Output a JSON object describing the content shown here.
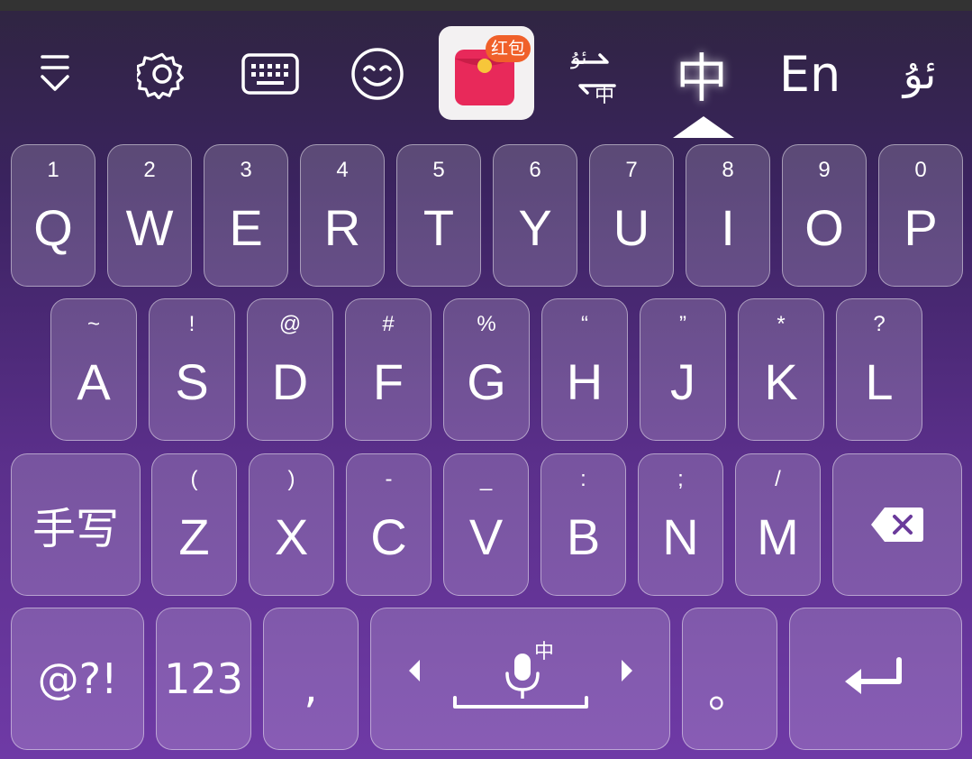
{
  "toolbar": {
    "items": [
      "collapse-icon",
      "settings-icon",
      "keyboard-icon",
      "emoji-icon",
      "red-packet-icon",
      "translate-icon"
    ],
    "hongbao_badge": "红包",
    "translate_top": "ئۇ",
    "translate_bottom": "中",
    "lang_chinese": "中",
    "lang_english": "En",
    "lang_uyghur": "ئۇ"
  },
  "rows": {
    "row1": [
      {
        "sub": "1",
        "main": "Q"
      },
      {
        "sub": "2",
        "main": "W"
      },
      {
        "sub": "3",
        "main": "E"
      },
      {
        "sub": "4",
        "main": "R"
      },
      {
        "sub": "5",
        "main": "T"
      },
      {
        "sub": "6",
        "main": "Y"
      },
      {
        "sub": "7",
        "main": "U"
      },
      {
        "sub": "8",
        "main": "I"
      },
      {
        "sub": "9",
        "main": "O"
      },
      {
        "sub": "0",
        "main": "P"
      }
    ],
    "row2": [
      {
        "sub": "~",
        "main": "A"
      },
      {
        "sub": "!",
        "main": "S"
      },
      {
        "sub": "@",
        "main": "D"
      },
      {
        "sub": "#",
        "main": "F"
      },
      {
        "sub": "%",
        "main": "G"
      },
      {
        "sub": "“",
        "main": "H"
      },
      {
        "sub": "”",
        "main": "J"
      },
      {
        "sub": "*",
        "main": "K"
      },
      {
        "sub": "?",
        "main": "L"
      }
    ],
    "row3": [
      {
        "sub": "(",
        "main": "Z"
      },
      {
        "sub": ")",
        "main": "X"
      },
      {
        "sub": "-",
        "main": "C"
      },
      {
        "sub": "_",
        "main": "V"
      },
      {
        "sub": ":",
        "main": "B"
      },
      {
        "sub": ";",
        "main": "N"
      },
      {
        "sub": "/",
        "main": "M"
      }
    ]
  },
  "keys": {
    "handwrite": "手写",
    "symbols": "@?!",
    "numbers": "123",
    "comma": ",",
    "voice_lang": "中",
    "period": "。"
  }
}
